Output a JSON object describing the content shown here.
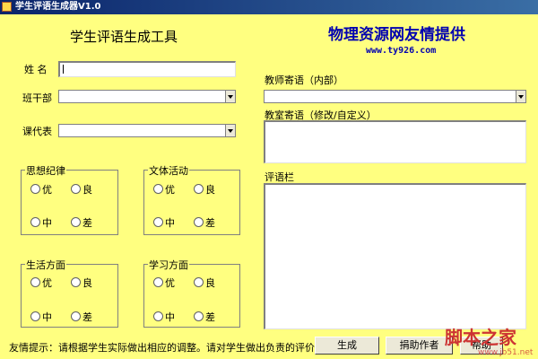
{
  "window": {
    "title": "学生评语生成器V1.0"
  },
  "heading": "学生评语生成工具",
  "site": {
    "title": "物理资源网友情提供",
    "url": "www.ty926.com"
  },
  "fields": {
    "name_label": "姓 名",
    "name_value": "",
    "class_cadre_label": "班干部",
    "class_cadre_value": "",
    "course_rep_label": "课代表",
    "course_rep_value": ""
  },
  "right": {
    "teacher_msg_label": "教师寄语（内部）",
    "teacher_msg_value": "",
    "classroom_msg_label": "教室寄语（修改/自定义）",
    "classroom_msg_value": "",
    "comment_label": "评语栏",
    "comment_value": ""
  },
  "groups": [
    {
      "title": "思想纪律",
      "options": [
        "优",
        "良",
        "中",
        "差"
      ]
    },
    {
      "title": "文体活动",
      "options": [
        "优",
        "良",
        "中",
        "差"
      ]
    },
    {
      "title": "生活方面",
      "options": [
        "优",
        "良",
        "中",
        "差"
      ]
    },
    {
      "title": "学习方面",
      "options": [
        "优",
        "良",
        "中",
        "差"
      ]
    }
  ],
  "footer": {
    "tip": "友情提示：请根据学生实际做出相应的调整。请对学生做出负责的评价。",
    "generate_button": "生成",
    "donate_button": "捐助作者",
    "help_button": "帮助"
  },
  "watermark": {
    "text": "脚本之家",
    "url": "www.jb51.net"
  }
}
